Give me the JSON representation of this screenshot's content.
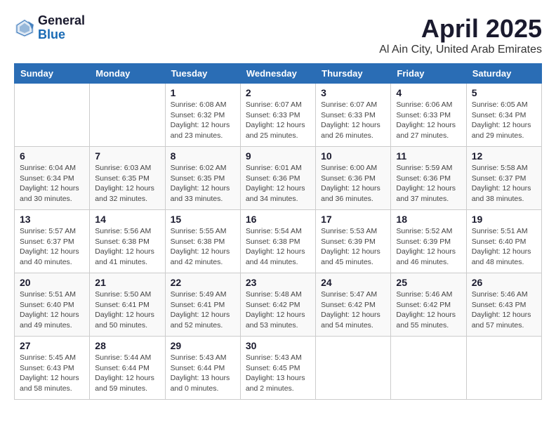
{
  "logo": {
    "general": "General",
    "blue": "Blue"
  },
  "title": "April 2025",
  "location": "Al Ain City, United Arab Emirates",
  "weekdays": [
    "Sunday",
    "Monday",
    "Tuesday",
    "Wednesday",
    "Thursday",
    "Friday",
    "Saturday"
  ],
  "weeks": [
    [
      {
        "day": "",
        "info": ""
      },
      {
        "day": "",
        "info": ""
      },
      {
        "day": "1",
        "info": "Sunrise: 6:08 AM\nSunset: 6:32 PM\nDaylight: 12 hours and 23 minutes."
      },
      {
        "day": "2",
        "info": "Sunrise: 6:07 AM\nSunset: 6:33 PM\nDaylight: 12 hours and 25 minutes."
      },
      {
        "day": "3",
        "info": "Sunrise: 6:07 AM\nSunset: 6:33 PM\nDaylight: 12 hours and 26 minutes."
      },
      {
        "day": "4",
        "info": "Sunrise: 6:06 AM\nSunset: 6:33 PM\nDaylight: 12 hours and 27 minutes."
      },
      {
        "day": "5",
        "info": "Sunrise: 6:05 AM\nSunset: 6:34 PM\nDaylight: 12 hours and 29 minutes."
      }
    ],
    [
      {
        "day": "6",
        "info": "Sunrise: 6:04 AM\nSunset: 6:34 PM\nDaylight: 12 hours and 30 minutes."
      },
      {
        "day": "7",
        "info": "Sunrise: 6:03 AM\nSunset: 6:35 PM\nDaylight: 12 hours and 32 minutes."
      },
      {
        "day": "8",
        "info": "Sunrise: 6:02 AM\nSunset: 6:35 PM\nDaylight: 12 hours and 33 minutes."
      },
      {
        "day": "9",
        "info": "Sunrise: 6:01 AM\nSunset: 6:36 PM\nDaylight: 12 hours and 34 minutes."
      },
      {
        "day": "10",
        "info": "Sunrise: 6:00 AM\nSunset: 6:36 PM\nDaylight: 12 hours and 36 minutes."
      },
      {
        "day": "11",
        "info": "Sunrise: 5:59 AM\nSunset: 6:36 PM\nDaylight: 12 hours and 37 minutes."
      },
      {
        "day": "12",
        "info": "Sunrise: 5:58 AM\nSunset: 6:37 PM\nDaylight: 12 hours and 38 minutes."
      }
    ],
    [
      {
        "day": "13",
        "info": "Sunrise: 5:57 AM\nSunset: 6:37 PM\nDaylight: 12 hours and 40 minutes."
      },
      {
        "day": "14",
        "info": "Sunrise: 5:56 AM\nSunset: 6:38 PM\nDaylight: 12 hours and 41 minutes."
      },
      {
        "day": "15",
        "info": "Sunrise: 5:55 AM\nSunset: 6:38 PM\nDaylight: 12 hours and 42 minutes."
      },
      {
        "day": "16",
        "info": "Sunrise: 5:54 AM\nSunset: 6:38 PM\nDaylight: 12 hours and 44 minutes."
      },
      {
        "day": "17",
        "info": "Sunrise: 5:53 AM\nSunset: 6:39 PM\nDaylight: 12 hours and 45 minutes."
      },
      {
        "day": "18",
        "info": "Sunrise: 5:52 AM\nSunset: 6:39 PM\nDaylight: 12 hours and 46 minutes."
      },
      {
        "day": "19",
        "info": "Sunrise: 5:51 AM\nSunset: 6:40 PM\nDaylight: 12 hours and 48 minutes."
      }
    ],
    [
      {
        "day": "20",
        "info": "Sunrise: 5:51 AM\nSunset: 6:40 PM\nDaylight: 12 hours and 49 minutes."
      },
      {
        "day": "21",
        "info": "Sunrise: 5:50 AM\nSunset: 6:41 PM\nDaylight: 12 hours and 50 minutes."
      },
      {
        "day": "22",
        "info": "Sunrise: 5:49 AM\nSunset: 6:41 PM\nDaylight: 12 hours and 52 minutes."
      },
      {
        "day": "23",
        "info": "Sunrise: 5:48 AM\nSunset: 6:42 PM\nDaylight: 12 hours and 53 minutes."
      },
      {
        "day": "24",
        "info": "Sunrise: 5:47 AM\nSunset: 6:42 PM\nDaylight: 12 hours and 54 minutes."
      },
      {
        "day": "25",
        "info": "Sunrise: 5:46 AM\nSunset: 6:42 PM\nDaylight: 12 hours and 55 minutes."
      },
      {
        "day": "26",
        "info": "Sunrise: 5:46 AM\nSunset: 6:43 PM\nDaylight: 12 hours and 57 minutes."
      }
    ],
    [
      {
        "day": "27",
        "info": "Sunrise: 5:45 AM\nSunset: 6:43 PM\nDaylight: 12 hours and 58 minutes."
      },
      {
        "day": "28",
        "info": "Sunrise: 5:44 AM\nSunset: 6:44 PM\nDaylight: 12 hours and 59 minutes."
      },
      {
        "day": "29",
        "info": "Sunrise: 5:43 AM\nSunset: 6:44 PM\nDaylight: 13 hours and 0 minutes."
      },
      {
        "day": "30",
        "info": "Sunrise: 5:43 AM\nSunset: 6:45 PM\nDaylight: 13 hours and 2 minutes."
      },
      {
        "day": "",
        "info": ""
      },
      {
        "day": "",
        "info": ""
      },
      {
        "day": "",
        "info": ""
      }
    ]
  ]
}
